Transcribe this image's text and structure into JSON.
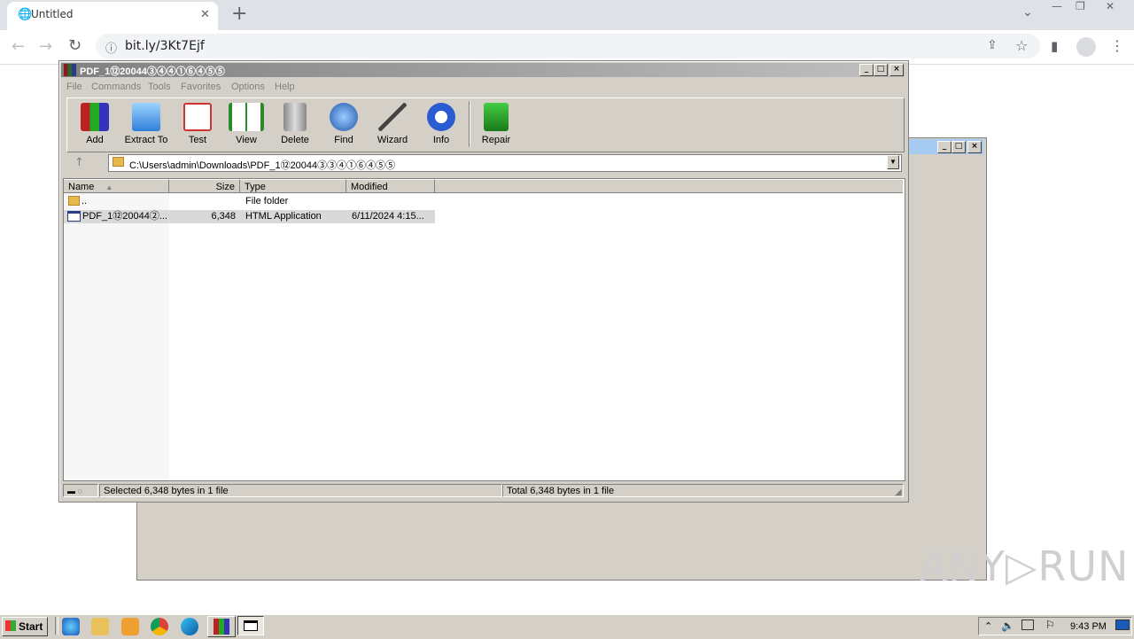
{
  "browser": {
    "tab_title": "Untitled",
    "tab_close": "✕",
    "new_tab": "+",
    "url": "bit.ly/3Kt7Ejf",
    "window_controls": [
      "—",
      "❐",
      "✕"
    ]
  },
  "winrar": {
    "title": "PDF_1⑫20044③④④①⑥④⑤⑤",
    "menu": [
      "File",
      "Commands",
      "Tools",
      "Favorites",
      "Options",
      "Help"
    ],
    "toolbar": [
      {
        "label": "Add",
        "icon": "add-archive-icon"
      },
      {
        "label": "Extract To",
        "icon": "extract-folder-icon"
      },
      {
        "label": "Test",
        "icon": "test-clipboard-icon"
      },
      {
        "label": "View",
        "icon": "view-book-icon"
      },
      {
        "label": "Delete",
        "icon": "trash-icon"
      },
      {
        "label": "Find",
        "icon": "magnifier-icon"
      },
      {
        "label": "Wizard",
        "icon": "magic-wand-icon"
      },
      {
        "label": "Info",
        "icon": "info-icon"
      },
      {
        "label": "Repair",
        "icon": "repair-kit-icon"
      }
    ],
    "address": "C:\\Users\\admin\\Downloads\\PDF_1⑫20044③③④①⑥④⑤⑤",
    "columns": {
      "name": "Name",
      "size": "Size",
      "type": "Type",
      "modified": "Modified"
    },
    "rows": [
      {
        "name": "..",
        "size": "",
        "type": "File folder",
        "modified": ""
      },
      {
        "name": "PDF_1⑫20044②...",
        "size": "6,348",
        "type": "HTML Application",
        "modified": "6/11/2024 4:15..."
      }
    ],
    "status_left": "Selected 6,348 bytes in 1 file",
    "status_right": "Total 6,348 bytes in 1 file"
  },
  "taskbar": {
    "start_label": "Start",
    "clock": "9:43 PM"
  },
  "watermark": "ANY▷RUN"
}
